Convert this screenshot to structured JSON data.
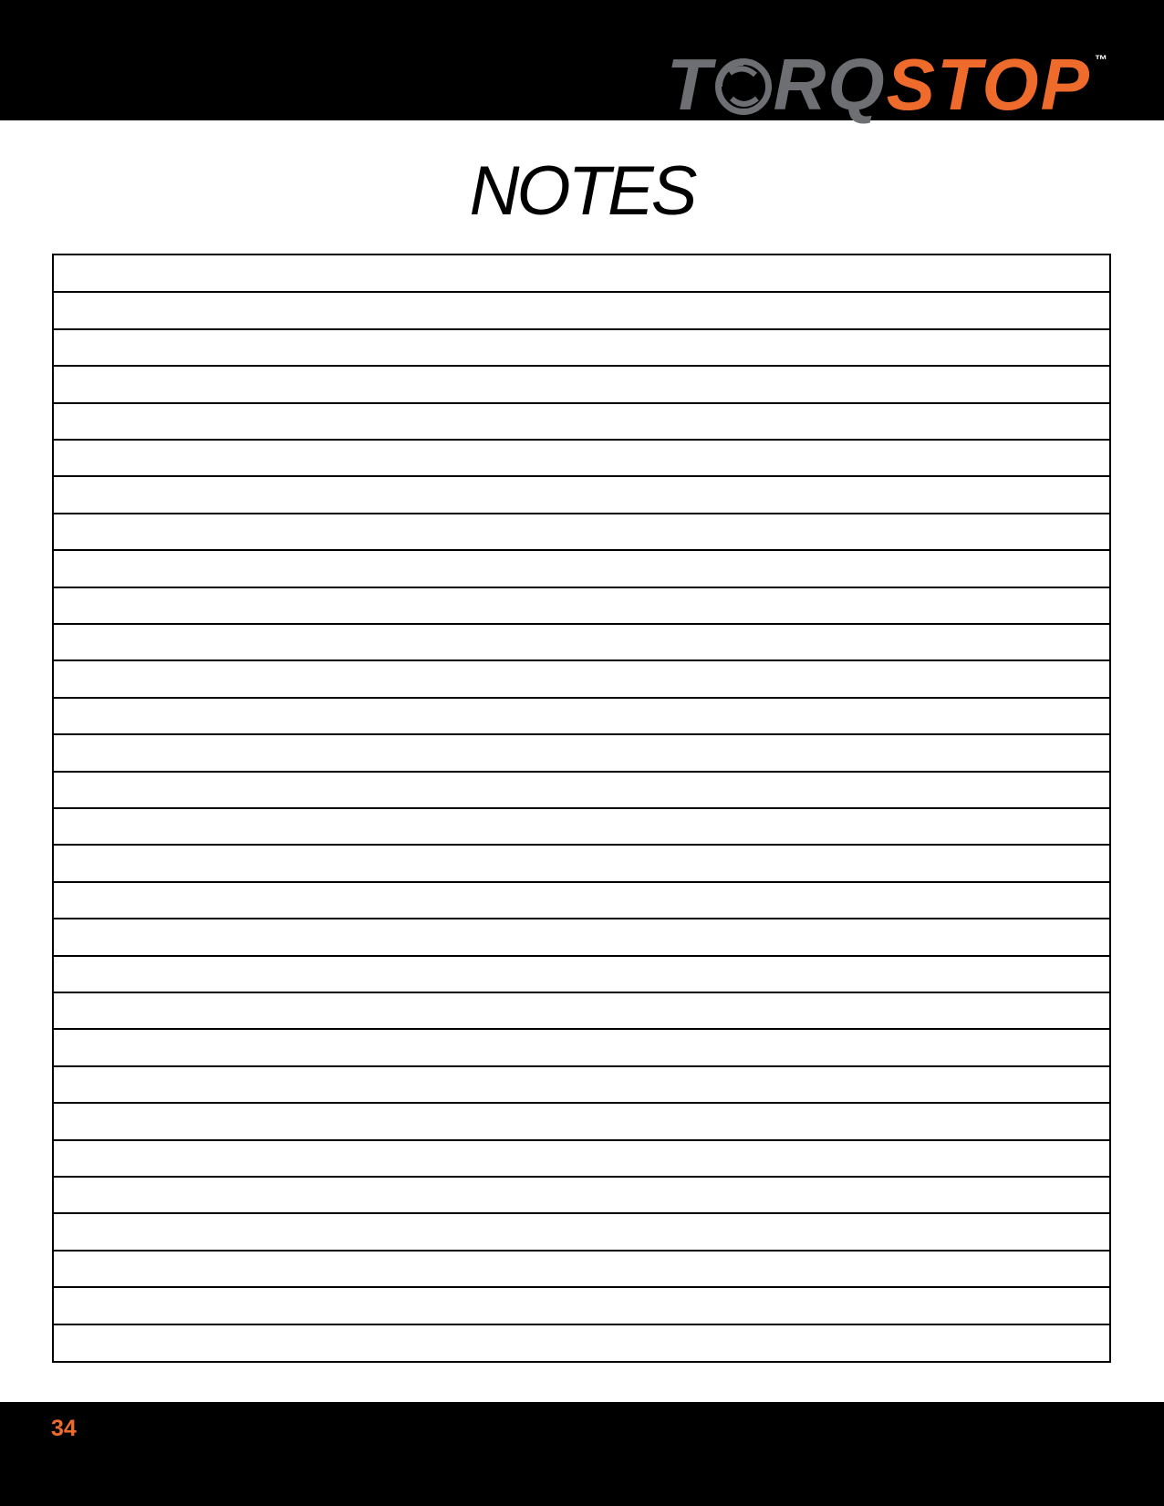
{
  "header": {
    "logo": {
      "part1_a": "T",
      "part1_b": "RQ",
      "part2": "STOP",
      "trademark": "™",
      "icon": "swirl-o-icon",
      "colors": {
        "torq": "#6d6f72",
        "stop": "#ef6b2b"
      }
    }
  },
  "page": {
    "title": "NOTES",
    "ruled_rows": 30
  },
  "footer": {
    "page_number": "34"
  },
  "colors": {
    "bars": "#000000",
    "accent": "#ef6b2b"
  }
}
